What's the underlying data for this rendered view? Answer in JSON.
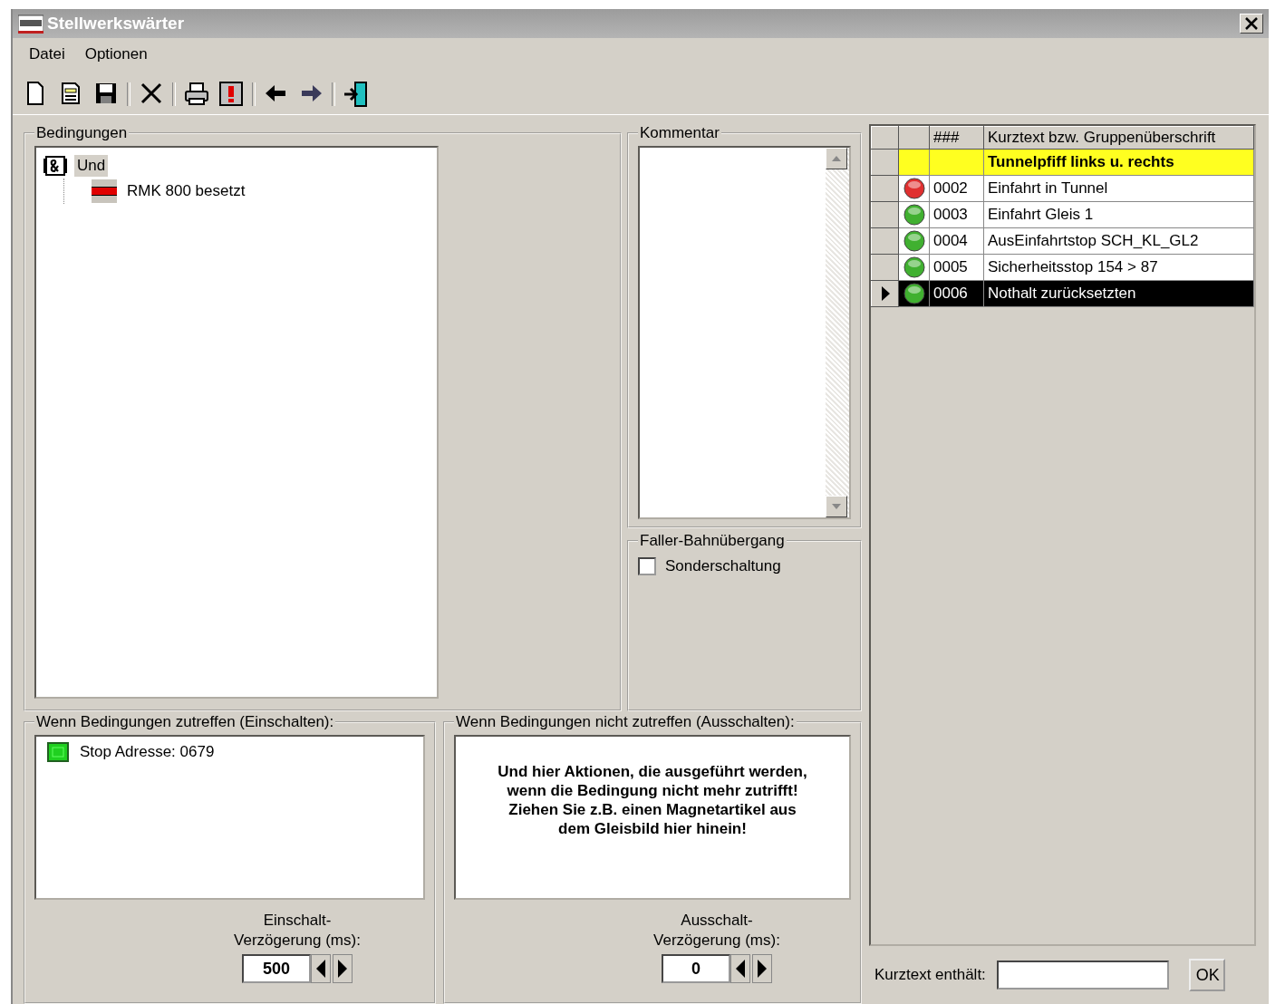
{
  "window": {
    "title": "Stellwerkswärter"
  },
  "menu": [
    "Datei",
    "Optionen"
  ],
  "conditions": {
    "title": "Bedingungen",
    "tree": [
      {
        "label": "Und",
        "kind": "and",
        "selected": true,
        "children": [
          {
            "label": "RMK 800 besetzt",
            "kind": "contact",
            "selected": false
          }
        ]
      }
    ]
  },
  "comment": {
    "title": "Kommentar"
  },
  "crossing": {
    "title": "Faller-Bahnübergang",
    "options": [
      {
        "label": "Sonderschaltung",
        "checked": false
      }
    ]
  },
  "on_actions": {
    "title": "Wenn Bedingungen zutreffen (Einschalten):",
    "items": [
      {
        "label": "Stop Adresse: 0679"
      }
    ],
    "delay_label": [
      "Einschalt-",
      "Verzögerung (ms):"
    ],
    "delay_value": "500"
  },
  "off_actions": {
    "title": "Wenn Bedingungen nicht zutreffen (Ausschalten):",
    "hint": "Und hier Aktionen, die ausgeführt werden, wenn die Bedingung nicht mehr zutrifft! Ziehen Sie z.B. einen Magnetartikel aus dem Gleisbild hier hinein!",
    "delay_label": [
      "Ausschalt-",
      "Verzögerung (ms):"
    ],
    "delay_value": "0"
  },
  "table": {
    "columns": [
      "###",
      "Kurztext bzw. Gruppenüberschrift"
    ],
    "rows": [
      {
        "kind": "group",
        "text": "Tunnelpfiff links u. rechts",
        "selected": false
      },
      {
        "kind": "item",
        "number": "0002",
        "text": "Einfahrt in Tunnel",
        "color": "#e03030",
        "selected": false
      },
      {
        "kind": "item",
        "number": "0003",
        "text": "Einfahrt Gleis 1",
        "color": "#40b030",
        "selected": false
      },
      {
        "kind": "item",
        "number": "0004",
        "text": "AusEinfahrtstop SCH_KL_GL2",
        "color": "#40b030",
        "selected": false
      },
      {
        "kind": "item",
        "number": "0005",
        "text": "Sicherheitsstop 154 > 87",
        "color": "#40b030",
        "selected": false
      },
      {
        "kind": "item",
        "number": "0006",
        "text": "Nothalt zurücksetzten",
        "color": "#40b030",
        "selected": true
      }
    ]
  },
  "filter": {
    "label": "Kurztext enthält:",
    "button": "OK"
  }
}
